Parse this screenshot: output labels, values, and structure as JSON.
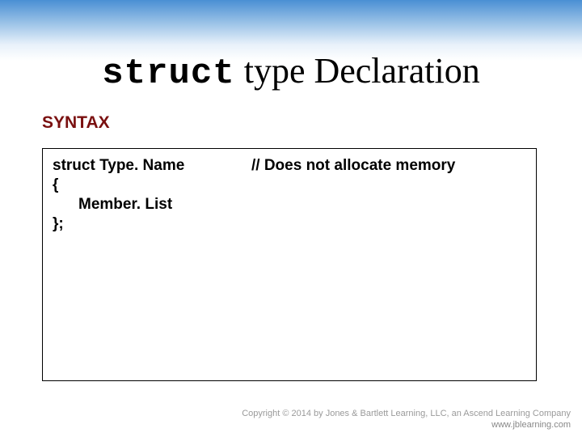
{
  "title": {
    "keyword": "struct",
    "rest": " type Declaration"
  },
  "syntax_label": "SYNTAX",
  "code": {
    "line1": "struct  Type. Name",
    "comment": "// Does not  allocate memory",
    "line2": "{",
    "line3": "Member. List",
    "line4": "};"
  },
  "footer": {
    "line1": "Copyright © 2014 by Jones & Bartlett Learning, LLC, an Ascend Learning Company",
    "line2": "www.jblearning.com"
  }
}
